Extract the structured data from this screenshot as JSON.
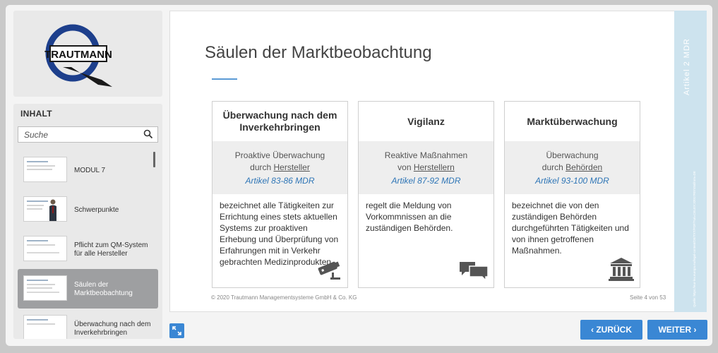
{
  "logo": {
    "text": "TRAUTMANN"
  },
  "toc": {
    "header": "INHALT",
    "search_placeholder": "Suche",
    "items": [
      {
        "label": "MODUL 7",
        "active": false
      },
      {
        "label": "Schwerpunkte",
        "active": false
      },
      {
        "label": "Pflicht zum QM-System für alle Hersteller",
        "active": false
      },
      {
        "label": "Säulen der Marktbeobachtung",
        "active": true
      },
      {
        "label": "Überwachung nach dem Inverkehrbringen",
        "active": false
      }
    ]
  },
  "slide": {
    "title": "Säulen der Marktbeobachtung",
    "cards": [
      {
        "title": "Überwachung nach dem Inverkehrbringen",
        "mid_line1": "Proaktive Überwachung",
        "mid_line2_pre": "durch ",
        "mid_line2_u": "Hersteller",
        "ref": "Artikel 83-86 MDR",
        "body": "bezeichnet alle Tätigkeiten zur Errichtung eines stets aktuellen Systems zur proaktiven Erhebung und Überprüfung von Erfahrungen mit in Verkehr gebrachten Medizinprodukten.",
        "icon": "security-camera-icon"
      },
      {
        "title": "Vigilanz",
        "mid_line1": "Reaktive Maßnahmen",
        "mid_line2_pre": "von ",
        "mid_line2_u": "Herstellern",
        "ref": "Artikel 87-92 MDR",
        "body": "regelt die Meldung von Vorkommnissen an die zuständigen Behörden.",
        "icon": "speech-bubbles-icon"
      },
      {
        "title": "Marktüberwachung",
        "mid_line1": "Überwachung",
        "mid_line2_pre": "durch ",
        "mid_line2_u": "Behörden",
        "ref": "Artikel 93-100 MDR",
        "body": "bezeichnet die von den zuständigen Behörden durchgeführten Tätigkeiten und von ihnen getroffenen Maßnahmen.",
        "icon": "government-building-icon"
      }
    ],
    "footer_left": "© 2020 Trautmann Managementsysteme GmbH & Co. KG",
    "footer_right": "Seite 4 von 53"
  },
  "side_banner": {
    "article": "Artikel 2  MDR",
    "source": "Quelle: https://eur-lex.europa.eu/legal-content/DE/TXT/PDF/?uri=CELEX:32017R0745&from=DE"
  },
  "nav": {
    "back_label": "ZURÜCK",
    "next_label": "WEITER"
  },
  "colors": {
    "accent": "#3a87d4",
    "banner": "#cde3ee",
    "active_item": "#9e9fa1"
  }
}
